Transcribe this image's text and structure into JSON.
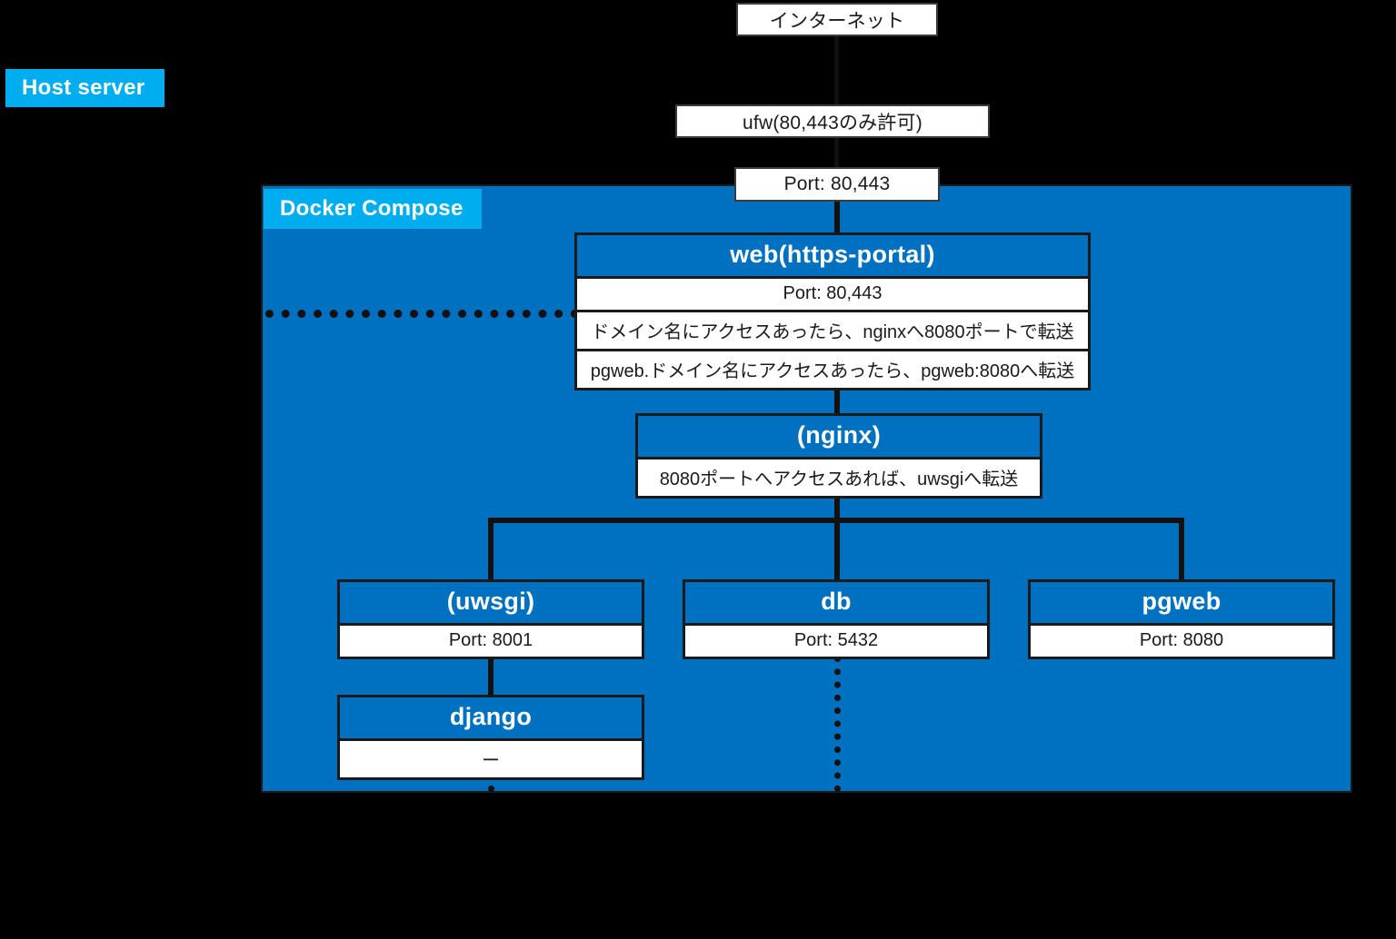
{
  "diagram": {
    "title": "Host server / Docker Compose architecture",
    "background_color": "#000000",
    "container_color": "#0070C0",
    "chip_color": "#00ADEF",
    "line_color": "#111111"
  },
  "labels": {
    "host_server": "Host server",
    "docker_compose": "Docker Compose"
  },
  "nodes": {
    "internet": "インターネット",
    "ufw": "ufw(80,443のみ許可)",
    "port_entry": "Port: 80,443"
  },
  "services": {
    "web": {
      "title": "web(https-portal)",
      "rows": [
        "Port: 80,443",
        "ドメイン名にアクセスあったら、nginxへ8080ポートで転送",
        "pgweb.ドメイン名にアクセスあったら、pgweb:8080へ転送"
      ]
    },
    "nginx": {
      "title": "(nginx)",
      "rows": [
        "8080ポートへアクセスあれば、uwsgiへ転送"
      ]
    },
    "uwsgi": {
      "title": "(uwsgi)",
      "rows": [
        "Port: 8001"
      ]
    },
    "db": {
      "title": "db",
      "rows": [
        "Port: 5432"
      ]
    },
    "pgweb": {
      "title": "pgweb",
      "rows": [
        "Port: 8080"
      ]
    },
    "django": {
      "title": "django",
      "rows": [
        "ー"
      ]
    }
  }
}
